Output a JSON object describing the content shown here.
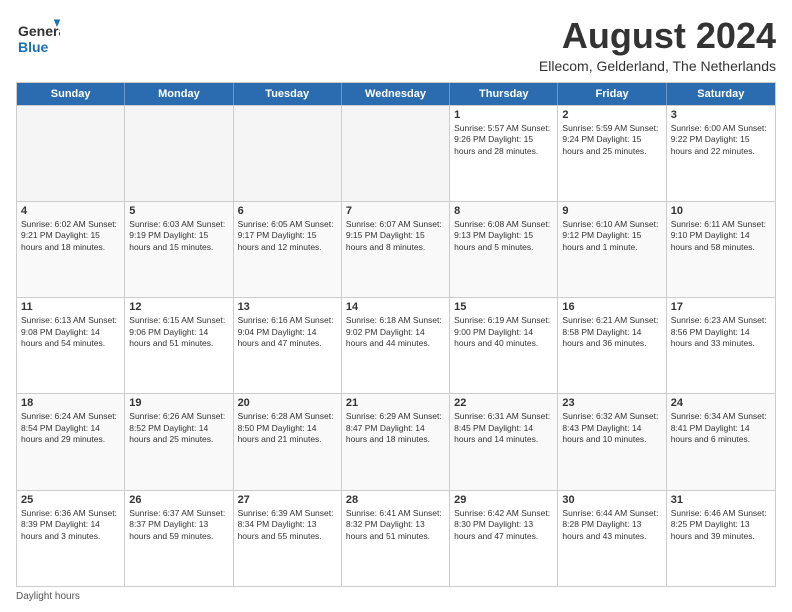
{
  "logo": {
    "line1": "General",
    "line2": "Blue"
  },
  "title": "August 2024",
  "subtitle": "Ellecom, Gelderland, The Netherlands",
  "days_of_week": [
    "Sunday",
    "Monday",
    "Tuesday",
    "Wednesday",
    "Thursday",
    "Friday",
    "Saturday"
  ],
  "footer": "Daylight hours",
  "weeks": [
    [
      {
        "day": "",
        "info": "",
        "empty": true
      },
      {
        "day": "",
        "info": "",
        "empty": true
      },
      {
        "day": "",
        "info": "",
        "empty": true
      },
      {
        "day": "",
        "info": "",
        "empty": true
      },
      {
        "day": "1",
        "info": "Sunrise: 5:57 AM\nSunset: 9:26 PM\nDaylight: 15 hours\nand 28 minutes."
      },
      {
        "day": "2",
        "info": "Sunrise: 5:59 AM\nSunset: 9:24 PM\nDaylight: 15 hours\nand 25 minutes."
      },
      {
        "day": "3",
        "info": "Sunrise: 6:00 AM\nSunset: 9:22 PM\nDaylight: 15 hours\nand 22 minutes."
      }
    ],
    [
      {
        "day": "4",
        "info": "Sunrise: 6:02 AM\nSunset: 9:21 PM\nDaylight: 15 hours\nand 18 minutes."
      },
      {
        "day": "5",
        "info": "Sunrise: 6:03 AM\nSunset: 9:19 PM\nDaylight: 15 hours\nand 15 minutes."
      },
      {
        "day": "6",
        "info": "Sunrise: 6:05 AM\nSunset: 9:17 PM\nDaylight: 15 hours\nand 12 minutes."
      },
      {
        "day": "7",
        "info": "Sunrise: 6:07 AM\nSunset: 9:15 PM\nDaylight: 15 hours\nand 8 minutes."
      },
      {
        "day": "8",
        "info": "Sunrise: 6:08 AM\nSunset: 9:13 PM\nDaylight: 15 hours\nand 5 minutes."
      },
      {
        "day": "9",
        "info": "Sunrise: 6:10 AM\nSunset: 9:12 PM\nDaylight: 15 hours\nand 1 minute."
      },
      {
        "day": "10",
        "info": "Sunrise: 6:11 AM\nSunset: 9:10 PM\nDaylight: 14 hours\nand 58 minutes."
      }
    ],
    [
      {
        "day": "11",
        "info": "Sunrise: 6:13 AM\nSunset: 9:08 PM\nDaylight: 14 hours\nand 54 minutes."
      },
      {
        "day": "12",
        "info": "Sunrise: 6:15 AM\nSunset: 9:06 PM\nDaylight: 14 hours\nand 51 minutes."
      },
      {
        "day": "13",
        "info": "Sunrise: 6:16 AM\nSunset: 9:04 PM\nDaylight: 14 hours\nand 47 minutes."
      },
      {
        "day": "14",
        "info": "Sunrise: 6:18 AM\nSunset: 9:02 PM\nDaylight: 14 hours\nand 44 minutes."
      },
      {
        "day": "15",
        "info": "Sunrise: 6:19 AM\nSunset: 9:00 PM\nDaylight: 14 hours\nand 40 minutes."
      },
      {
        "day": "16",
        "info": "Sunrise: 6:21 AM\nSunset: 8:58 PM\nDaylight: 14 hours\nand 36 minutes."
      },
      {
        "day": "17",
        "info": "Sunrise: 6:23 AM\nSunset: 8:56 PM\nDaylight: 14 hours\nand 33 minutes."
      }
    ],
    [
      {
        "day": "18",
        "info": "Sunrise: 6:24 AM\nSunset: 8:54 PM\nDaylight: 14 hours\nand 29 minutes."
      },
      {
        "day": "19",
        "info": "Sunrise: 6:26 AM\nSunset: 8:52 PM\nDaylight: 14 hours\nand 25 minutes."
      },
      {
        "day": "20",
        "info": "Sunrise: 6:28 AM\nSunset: 8:50 PM\nDaylight: 14 hours\nand 21 minutes."
      },
      {
        "day": "21",
        "info": "Sunrise: 6:29 AM\nSunset: 8:47 PM\nDaylight: 14 hours\nand 18 minutes."
      },
      {
        "day": "22",
        "info": "Sunrise: 6:31 AM\nSunset: 8:45 PM\nDaylight: 14 hours\nand 14 minutes."
      },
      {
        "day": "23",
        "info": "Sunrise: 6:32 AM\nSunset: 8:43 PM\nDaylight: 14 hours\nand 10 minutes."
      },
      {
        "day": "24",
        "info": "Sunrise: 6:34 AM\nSunset: 8:41 PM\nDaylight: 14 hours\nand 6 minutes."
      }
    ],
    [
      {
        "day": "25",
        "info": "Sunrise: 6:36 AM\nSunset: 8:39 PM\nDaylight: 14 hours\nand 3 minutes."
      },
      {
        "day": "26",
        "info": "Sunrise: 6:37 AM\nSunset: 8:37 PM\nDaylight: 13 hours\nand 59 minutes."
      },
      {
        "day": "27",
        "info": "Sunrise: 6:39 AM\nSunset: 8:34 PM\nDaylight: 13 hours\nand 55 minutes."
      },
      {
        "day": "28",
        "info": "Sunrise: 6:41 AM\nSunset: 8:32 PM\nDaylight: 13 hours\nand 51 minutes."
      },
      {
        "day": "29",
        "info": "Sunrise: 6:42 AM\nSunset: 8:30 PM\nDaylight: 13 hours\nand 47 minutes."
      },
      {
        "day": "30",
        "info": "Sunrise: 6:44 AM\nSunset: 8:28 PM\nDaylight: 13 hours\nand 43 minutes."
      },
      {
        "day": "31",
        "info": "Sunrise: 6:46 AM\nSunset: 8:25 PM\nDaylight: 13 hours\nand 39 minutes."
      }
    ]
  ]
}
